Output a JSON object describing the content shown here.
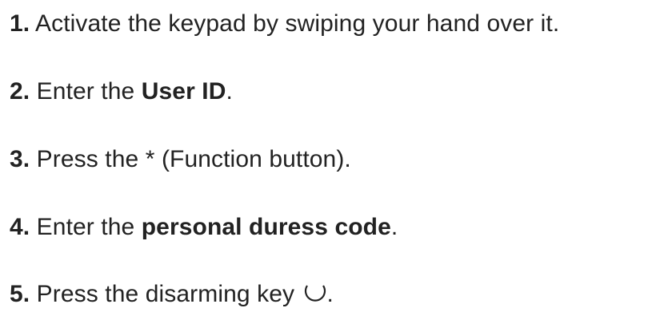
{
  "steps": [
    {
      "number": "1.",
      "text": " Activate the keypad by swiping your hand over it."
    },
    {
      "number": "2.",
      "prefix": " Enter the ",
      "emphasis": "User ID",
      "suffix": "."
    },
    {
      "number": "3.",
      "text": " Press the * (Function button)."
    },
    {
      "number": "4.",
      "prefix": " Enter the ",
      "emphasis": "personal duress code",
      "suffix": "."
    },
    {
      "number": "5.",
      "prefix": " Press the disarming key ",
      "icon": "disarm-key-icon",
      "suffix": "."
    }
  ]
}
